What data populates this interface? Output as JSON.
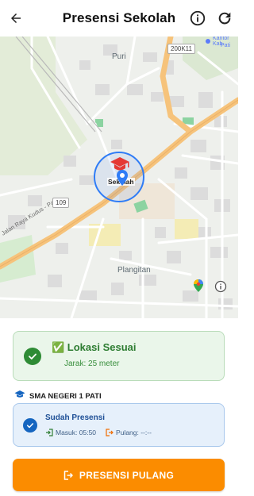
{
  "header": {
    "title": "Presensi Sekolah",
    "back_icon": "arrow-left-icon",
    "info_icon": "info-icon",
    "refresh_icon": "refresh-icon"
  },
  "map": {
    "labels": {
      "puri": "Puri",
      "plangitan": "Plangitan",
      "jalan": "Jalan Raya Kudus - Pati",
      "road_109": "109",
      "road_200k11": "200K11",
      "kantor": "Kantor Kab.",
      "pati_side": "Pati",
      "school_marker": "Sekolah"
    },
    "colors": {
      "major_road": "#f6c37b",
      "circle": "#2f7cf6",
      "school_pin": "#e53935"
    }
  },
  "status": {
    "title": "✅ Lokasi Sesuai",
    "distance": "Jarak: 25 meter"
  },
  "school": {
    "name": "SMA NEGERI 1 PATI"
  },
  "presensi": {
    "title": "Sudah Presensi",
    "masuk": "Masuk: 05:50",
    "pulang": "Pulang: --:--"
  },
  "action": {
    "label": "PRESENSI PULANG",
    "color": "#fb8c00"
  }
}
